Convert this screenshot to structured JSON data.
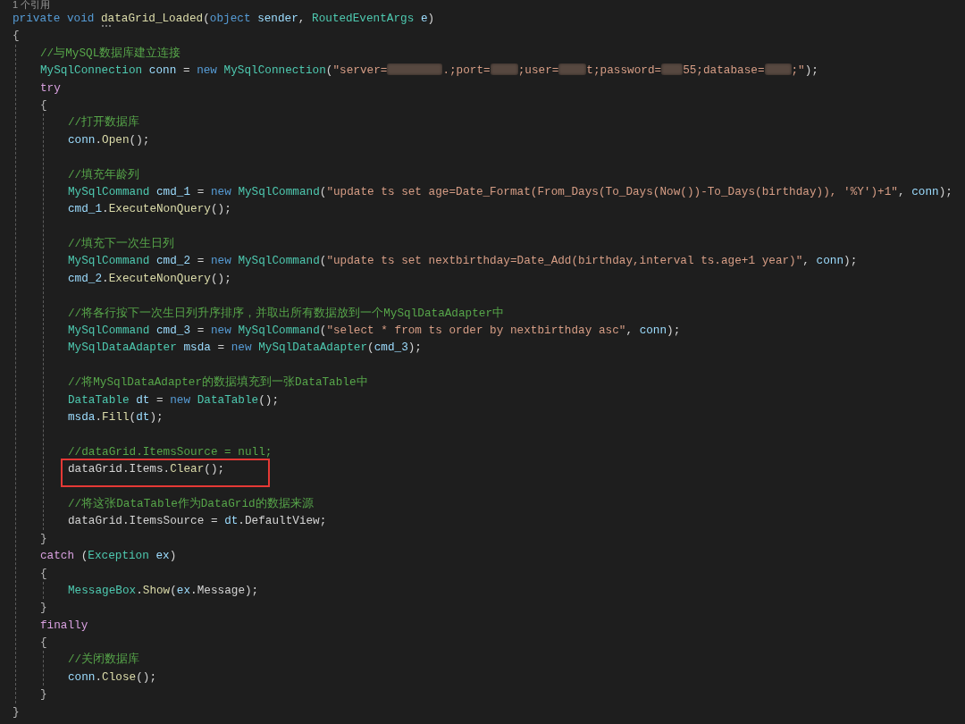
{
  "codelens": "1 个引用",
  "code": [
    {
      "kind": "line",
      "tokens": [
        {
          "kind": "keyword",
          "text": "private void "
        },
        {
          "kind": "method",
          "text": "dataGrid_Loaded",
          "hint": true
        },
        {
          "kind": "plain",
          "text": "("
        },
        {
          "kind": "keyword",
          "text": "object "
        },
        {
          "kind": "variable",
          "text": "sender"
        },
        {
          "kind": "plain",
          "text": ", "
        },
        {
          "kind": "type",
          "text": "RoutedEventArgs "
        },
        {
          "kind": "variable",
          "text": "e"
        },
        {
          "kind": "plain",
          "text": ")"
        }
      ]
    },
    {
      "kind": "block",
      "open": "{",
      "close": "}",
      "children": [
        {
          "kind": "line",
          "tokens": [
            {
              "kind": "comment",
              "text": "//与MySQL数据库建立连接"
            }
          ]
        },
        {
          "kind": "line",
          "tokens": [
            {
              "kind": "type",
              "text": "MySqlConnection "
            },
            {
              "kind": "variable",
              "text": "conn"
            },
            {
              "kind": "plain",
              "text": " = "
            },
            {
              "kind": "keyword",
              "text": "new "
            },
            {
              "kind": "type",
              "text": "MySqlConnection"
            },
            {
              "kind": "plain",
              "text": "("
            },
            {
              "kind": "string",
              "text": "\"server="
            },
            {
              "kind": "redacted"
            },
            {
              "kind": "string",
              "text": ".;port="
            },
            {
              "kind": "redacted"
            },
            {
              "kind": "string",
              "text": ";user="
            },
            {
              "kind": "redacted"
            },
            {
              "kind": "string",
              "text": "t;password="
            },
            {
              "kind": "redacted"
            },
            {
              "kind": "string",
              "text": "55;database="
            },
            {
              "kind": "redacted"
            },
            {
              "kind": "string",
              "text": ";\""
            },
            {
              "kind": "plain",
              "text": ");"
            }
          ]
        },
        {
          "kind": "line",
          "tokens": [
            {
              "kind": "control",
              "text": "try"
            }
          ]
        },
        {
          "kind": "block",
          "open": "{",
          "close": "}",
          "children": [
            {
              "kind": "line",
              "highlighted": false,
              "tokens": [
                {
                  "kind": "comment",
                  "text": "//打开数据库"
                }
              ]
            },
            {
              "kind": "line",
              "highlighted": false,
              "tokens": [
                {
                  "kind": "variable",
                  "text": "conn"
                },
                {
                  "kind": "plain",
                  "text": "."
                },
                {
                  "kind": "method",
                  "text": "Open"
                },
                {
                  "kind": "plain",
                  "text": "();"
                }
              ]
            },
            {
              "kind": "blank"
            },
            {
              "kind": "line",
              "highlighted": false,
              "tokens": [
                {
                  "kind": "comment",
                  "text": "//填充年龄列"
                }
              ]
            },
            {
              "kind": "line",
              "highlighted": false,
              "tokens": [
                {
                  "kind": "type",
                  "text": "MySqlCommand "
                },
                {
                  "kind": "variable",
                  "text": "cmd_1"
                },
                {
                  "kind": "plain",
                  "text": " = "
                },
                {
                  "kind": "keyword",
                  "text": "new "
                },
                {
                  "kind": "type",
                  "text": "MySqlCommand"
                },
                {
                  "kind": "plain",
                  "text": "("
                },
                {
                  "kind": "string",
                  "text": "\"update ts set age=Date_Format(From_Days(To_Days(Now())-To_Days(birthday)), '%Y')+1\""
                },
                {
                  "kind": "plain",
                  "text": ", "
                },
                {
                  "kind": "variable",
                  "text": "conn"
                },
                {
                  "kind": "plain",
                  "text": ");"
                }
              ]
            },
            {
              "kind": "line",
              "highlighted": false,
              "tokens": [
                {
                  "kind": "variable",
                  "text": "cmd_1"
                },
                {
                  "kind": "plain",
                  "text": "."
                },
                {
                  "kind": "method",
                  "text": "ExecuteNonQuery"
                },
                {
                  "kind": "plain",
                  "text": "();"
                }
              ]
            },
            {
              "kind": "blank"
            },
            {
              "kind": "line",
              "highlighted": false,
              "tokens": [
                {
                  "kind": "comment",
                  "text": "//填充下一次生日列"
                }
              ]
            },
            {
              "kind": "line",
              "highlighted": false,
              "tokens": [
                {
                  "kind": "type",
                  "text": "MySqlCommand "
                },
                {
                  "kind": "variable",
                  "text": "cmd_2"
                },
                {
                  "kind": "plain",
                  "text": " = "
                },
                {
                  "kind": "keyword",
                  "text": "new "
                },
                {
                  "kind": "type",
                  "text": "MySqlCommand"
                },
                {
                  "kind": "plain",
                  "text": "("
                },
                {
                  "kind": "string",
                  "text": "\"update ts set nextbirthday=Date_Add(birthday,interval ts.age+1 year)\""
                },
                {
                  "kind": "plain",
                  "text": ", "
                },
                {
                  "kind": "variable",
                  "text": "conn"
                },
                {
                  "kind": "plain",
                  "text": ");"
                }
              ]
            },
            {
              "kind": "line",
              "highlighted": false,
              "tokens": [
                {
                  "kind": "variable",
                  "text": "cmd_2"
                },
                {
                  "kind": "plain",
                  "text": "."
                },
                {
                  "kind": "method",
                  "text": "ExecuteNonQuery"
                },
                {
                  "kind": "plain",
                  "text": "();"
                }
              ]
            },
            {
              "kind": "blank"
            },
            {
              "kind": "line",
              "highlighted": false,
              "tokens": [
                {
                  "kind": "comment",
                  "text": "//将各行按下一次生日列升序排序，并取出所有数据放到一个MySqlDataAdapter中"
                }
              ]
            },
            {
              "kind": "line",
              "highlighted": false,
              "tokens": [
                {
                  "kind": "type",
                  "text": "MySqlCommand "
                },
                {
                  "kind": "variable",
                  "text": "cmd_3"
                },
                {
                  "kind": "plain",
                  "text": " = "
                },
                {
                  "kind": "keyword",
                  "text": "new "
                },
                {
                  "kind": "type",
                  "text": "MySqlCommand"
                },
                {
                  "kind": "plain",
                  "text": "("
                },
                {
                  "kind": "string",
                  "text": "\"select * from ts order by nextbirthday asc\""
                },
                {
                  "kind": "plain",
                  "text": ", "
                },
                {
                  "kind": "variable",
                  "text": "conn"
                },
                {
                  "kind": "plain",
                  "text": ");"
                }
              ]
            },
            {
              "kind": "line",
              "highlighted": false,
              "tokens": [
                {
                  "kind": "type",
                  "text": "MySqlDataAdapter "
                },
                {
                  "kind": "variable",
                  "text": "msda"
                },
                {
                  "kind": "plain",
                  "text": " = "
                },
                {
                  "kind": "keyword",
                  "text": "new "
                },
                {
                  "kind": "type",
                  "text": "MySqlDataAdapter"
                },
                {
                  "kind": "plain",
                  "text": "("
                },
                {
                  "kind": "variable",
                  "text": "cmd_3"
                },
                {
                  "kind": "plain",
                  "text": ");"
                }
              ]
            },
            {
              "kind": "blank"
            },
            {
              "kind": "line",
              "highlighted": false,
              "tokens": [
                {
                  "kind": "comment",
                  "text": "//将MySqlDataAdapter的数据填充到一张DataTable中"
                }
              ]
            },
            {
              "kind": "line",
              "highlighted": false,
              "tokens": [
                {
                  "kind": "type",
                  "text": "DataTable "
                },
                {
                  "kind": "variable",
                  "text": "dt"
                },
                {
                  "kind": "plain",
                  "text": " = "
                },
                {
                  "kind": "keyword",
                  "text": "new "
                },
                {
                  "kind": "type",
                  "text": "DataTable"
                },
                {
                  "kind": "plain",
                  "text": "();"
                }
              ]
            },
            {
              "kind": "line",
              "highlighted": false,
              "tokens": [
                {
                  "kind": "variable",
                  "text": "msda"
                },
                {
                  "kind": "plain",
                  "text": "."
                },
                {
                  "kind": "method",
                  "text": "Fill"
                },
                {
                  "kind": "plain",
                  "text": "("
                },
                {
                  "kind": "variable",
                  "text": "dt"
                },
                {
                  "kind": "plain",
                  "text": ");"
                }
              ]
            },
            {
              "kind": "blank"
            },
            {
              "kind": "line",
              "highlighted": false,
              "tokens": [
                {
                  "kind": "comment",
                  "text": "//dataGrid.ItemsSource = null;"
                }
              ]
            },
            {
              "kind": "line",
              "highlighted": true,
              "tokens": [
                {
                  "kind": "plain",
                  "text": "dataGrid.Items."
                },
                {
                  "kind": "method",
                  "text": "Clear"
                },
                {
                  "kind": "plain",
                  "text": "();"
                }
              ]
            },
            {
              "kind": "blank"
            },
            {
              "kind": "line",
              "highlighted": false,
              "tokens": [
                {
                  "kind": "comment",
                  "text": "//将这张DataTable作为DataGrid的数据来源"
                }
              ]
            },
            {
              "kind": "line",
              "highlighted": false,
              "tokens": [
                {
                  "kind": "plain",
                  "text": "dataGrid.ItemsSource = "
                },
                {
                  "kind": "variable",
                  "text": "dt"
                },
                {
                  "kind": "plain",
                  "text": ".DefaultView;"
                }
              ]
            }
          ]
        },
        {
          "kind": "line",
          "tokens": [
            {
              "kind": "control",
              "text": "catch "
            },
            {
              "kind": "plain",
              "text": "("
            },
            {
              "kind": "type",
              "text": "Exception "
            },
            {
              "kind": "variable",
              "text": "ex"
            },
            {
              "kind": "plain",
              "text": ")"
            }
          ]
        },
        {
          "kind": "block",
          "open": "{",
          "close": "}",
          "children": [
            {
              "kind": "line",
              "tokens": [
                {
                  "kind": "type",
                  "text": "MessageBox"
                },
                {
                  "kind": "plain",
                  "text": "."
                },
                {
                  "kind": "method",
                  "text": "Show"
                },
                {
                  "kind": "plain",
                  "text": "("
                },
                {
                  "kind": "variable",
                  "text": "ex"
                },
                {
                  "kind": "plain",
                  "text": ".Message);"
                }
              ]
            }
          ]
        },
        {
          "kind": "line",
          "tokens": [
            {
              "kind": "control",
              "text": "finally"
            }
          ]
        },
        {
          "kind": "block",
          "open": "{",
          "close": "}",
          "children": [
            {
              "kind": "line",
              "tokens": [
                {
                  "kind": "comment",
                  "text": "//关闭数据库"
                }
              ]
            },
            {
              "kind": "line",
              "tokens": [
                {
                  "kind": "variable",
                  "text": "conn"
                },
                {
                  "kind": "plain",
                  "text": "."
                },
                {
                  "kind": "method",
                  "text": "Close"
                },
                {
                  "kind": "plain",
                  "text": "();"
                }
              ]
            }
          ]
        }
      ]
    }
  ]
}
